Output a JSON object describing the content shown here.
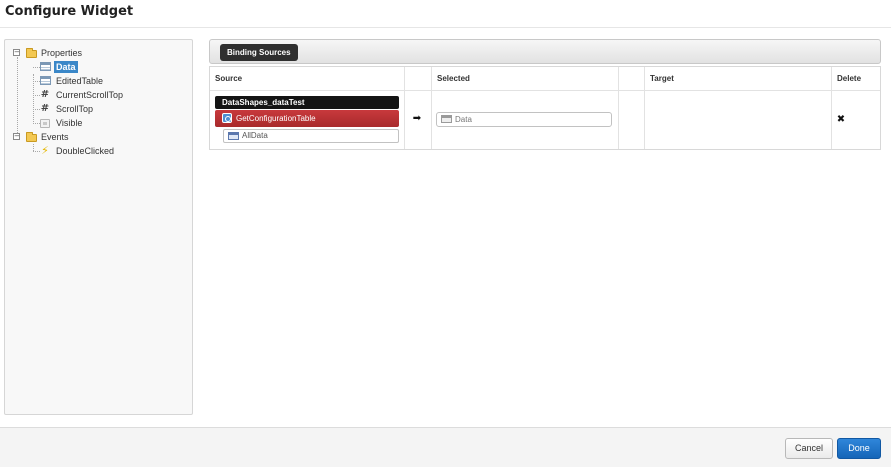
{
  "dialog": {
    "title": "Configure Widget"
  },
  "tree": {
    "properties": {
      "label": "Properties",
      "expander": "−",
      "items": [
        {
          "label": "Data",
          "icon": "table-icon",
          "selected": true
        },
        {
          "label": "EditedTable",
          "icon": "table-icon"
        },
        {
          "label": "CurrentScrollTop",
          "icon": "hash-icon"
        },
        {
          "label": "ScrollTop",
          "icon": "hash-icon"
        },
        {
          "label": "Visible",
          "icon": "boolean-icon"
        }
      ]
    },
    "events": {
      "label": "Events",
      "expander": "−",
      "items": [
        {
          "label": "DoubleClicked",
          "icon": "lightning-icon"
        }
      ]
    }
  },
  "bindings": {
    "tab_label": "Binding Sources",
    "columns": {
      "source": "Source",
      "selected": "Selected",
      "target": "Target",
      "delete": "Delete"
    },
    "source": {
      "entity": "DataShapes_dataTest",
      "service": "GetConfigurationTable",
      "output": "AllData"
    },
    "arrow": "➡",
    "selected": "Data",
    "target": "",
    "delete_glyph": "✖"
  },
  "footer": {
    "cancel_label": "Cancel",
    "done_label": "Done"
  },
  "colors": {
    "selection": "#3a87c8",
    "service_red": "#b52f32",
    "entity_black": "#141414",
    "primary_button": "#1f74c9"
  }
}
